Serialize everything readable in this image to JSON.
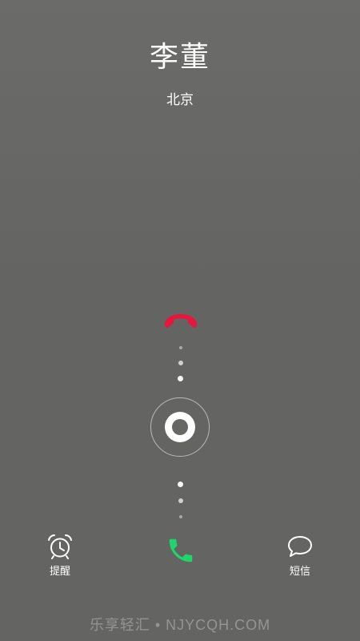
{
  "caller": {
    "name": "李董",
    "location": "北京"
  },
  "actions": {
    "remind_label": "提醒",
    "remind_icon": "alarm-clock-icon",
    "message_label": "短信",
    "message_icon": "speech-bubble-icon",
    "decline_icon": "hang-up-phone-icon",
    "answer_icon": "phone-icon"
  },
  "colors": {
    "decline": "#e8163c",
    "answer": "#1ed66a",
    "background": "#646462"
  },
  "watermark": {
    "text": "乐享轻汇 • NJYCQH.COM"
  }
}
